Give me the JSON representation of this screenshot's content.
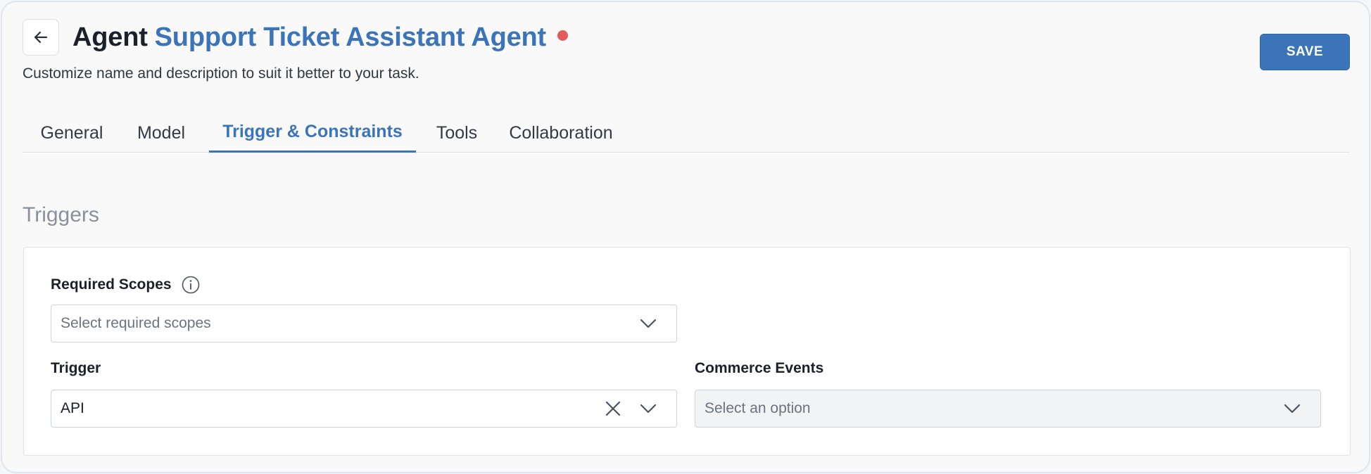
{
  "header": {
    "title_prefix": "Agent",
    "agent_name": "Support Ticket Assistant Agent",
    "subtitle": "Customize name and description to suit it better to your task.",
    "save_label": "SAVE",
    "unsaved_indicator_color": "#e35b5b"
  },
  "tabs": [
    {
      "label": "General",
      "active": false
    },
    {
      "label": "Model",
      "active": false
    },
    {
      "label": "Trigger & Constraints",
      "active": true
    },
    {
      "label": "Tools",
      "active": false
    },
    {
      "label": "Collaboration",
      "active": false
    }
  ],
  "triggers": {
    "section_title": "Triggers",
    "required_scopes": {
      "label": "Required Scopes",
      "placeholder": "Select required scopes"
    },
    "trigger": {
      "label": "Trigger",
      "value": "API"
    },
    "commerce_events": {
      "label": "Commerce Events",
      "placeholder": "Select an option",
      "disabled": true
    }
  },
  "colors": {
    "accent": "#3b74b9",
    "text": "#1b2029",
    "muted": "#8a919b"
  },
  "icons": {
    "back": "arrow-left-icon",
    "info": "info-icon",
    "dropdown": "chevron-down-icon",
    "clear": "close-icon"
  }
}
